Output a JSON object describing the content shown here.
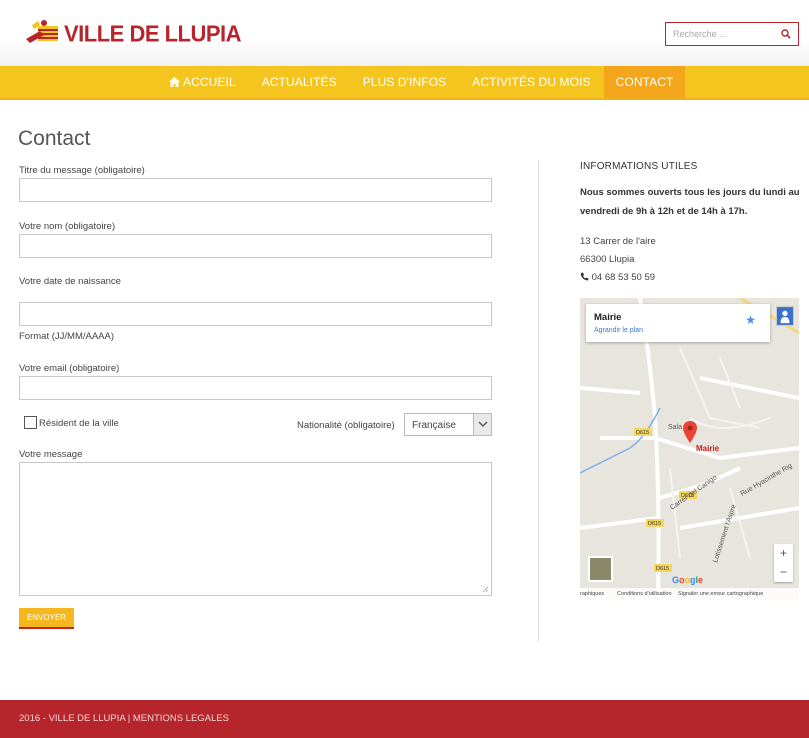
{
  "header": {
    "logo_text": "VILLE DE LLUPIA",
    "search_placeholder": "Recherche ..."
  },
  "nav": {
    "items": [
      {
        "label": "ACCUEIL",
        "icon": "home-icon"
      },
      {
        "label": "ACTUALITÉS"
      },
      {
        "label": "PLUS D'INFOS"
      },
      {
        "label": "ACTIVITÉS DU MOIS"
      },
      {
        "label": "CONTACT",
        "active": true
      }
    ]
  },
  "page": {
    "title": "Contact"
  },
  "form": {
    "title_label": "Titre du message (obligatoire)",
    "title_value": "",
    "name_label": "Votre nom (obligatoire)",
    "name_value": "",
    "birth_label": "Votre date de naissance",
    "birth_value": "",
    "birth_hint": "Format (JJ/MM/AAAA)",
    "email_label": "Votre email (obligatoire)",
    "email_value": "",
    "resident_label": "Résident de la ville",
    "resident_checked": false,
    "nationality_label": "Nationalité (obligatoire)",
    "nationality_value": "Française",
    "message_label": "Votre message",
    "message_value": "",
    "send_label": "ENVOYER"
  },
  "sidebar": {
    "title": "INFORMATIONS UTILES",
    "hours": "Nous sommes ouverts tous les jours du lundi au vendredi de 9h à 12h et de 14h à 17h.",
    "address_line1": "13 Carrer de l'aire",
    "address_line2": "66300 Llupia",
    "phone": "04 68 53 50 59"
  },
  "map": {
    "place_name": "Mairie",
    "enlarge_link": "Agrandir le plan",
    "marker_label": "Mairie",
    "labels": {
      "road_d615_a": "D615",
      "road_d615_b": "D615",
      "road_d615_c": "D615",
      "road_d615_d": "D615",
      "street_canigo": "Carrer del Canigo",
      "street_hyacinthe": "Rue Hyacinthe Rig",
      "street_lotissement": "Lotissement l'Aspre",
      "place_sala": "Sala"
    },
    "zoom_in": "+",
    "zoom_out": "−",
    "footer_data": "raphiques",
    "footer_terms": "Conditions d'utilisation",
    "footer_report": "Signaler une erreur cartographique",
    "google": "Google"
  },
  "footer": {
    "text": "2016 - VILLE DE LLUPIA | MENTIONS LEGALES"
  },
  "colors": {
    "brand_red": "#b5252b",
    "nav_yellow": "#f5c51f",
    "nav_active": "#f3a51c"
  }
}
